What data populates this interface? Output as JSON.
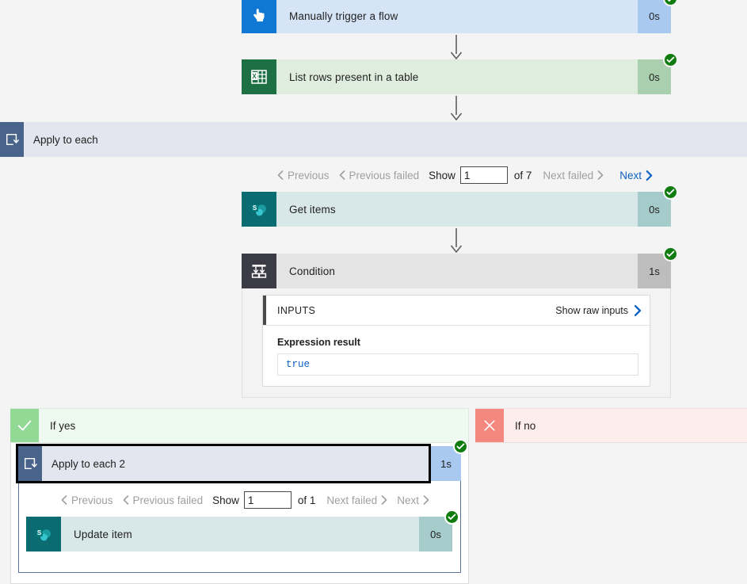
{
  "flow_run": {
    "background_color": "#f4f4f4",
    "status_badge_color": "#107c10",
    "link_color": "#0b61c4",
    "disabled_color": "#a19f9d"
  },
  "steps": {
    "trigger": {
      "name": "Manually trigger a flow",
      "duration": "0s",
      "icon": "tap-hand-icon",
      "icon_bg": "#0f78d4",
      "theme": "blue",
      "status": "succeeded"
    },
    "list_rows": {
      "name": "List rows present in a table",
      "duration": "0s",
      "icon": "excel-icon",
      "icon_bg": "#1d7044",
      "theme": "green",
      "status": "succeeded"
    },
    "get_items": {
      "name": "Get items",
      "duration": "0s",
      "icon": "sharepoint-icon",
      "icon_bg": "#0a6c71",
      "theme": "teal",
      "status": "succeeded"
    },
    "condition": {
      "name": "Condition",
      "duration": "1s",
      "icon": "condition-branch-icon",
      "icon_bg": "#3b3b45",
      "theme": "gray",
      "status": "succeeded"
    },
    "update_item": {
      "name": "Update item",
      "duration": "0s",
      "icon": "sharepoint-icon",
      "icon_bg": "#0a6c71",
      "theme": "teal",
      "status": "succeeded"
    }
  },
  "apply_to_each": {
    "label": "Apply to each",
    "icon": "loop-icon",
    "pager": {
      "previous_label": "Previous",
      "previous_failed_label": "Previous failed",
      "show_label": "Show",
      "page_value": "1",
      "of_label": "of 7",
      "next_failed_label": "Next failed",
      "next_label": "Next",
      "previous_enabled": false,
      "previous_failed_enabled": false,
      "next_failed_enabled": false,
      "next_enabled": true
    }
  },
  "apply_to_each_2": {
    "label": "Apply to each 2",
    "icon": "loop-icon",
    "duration": "1s",
    "status": "succeeded",
    "selected": true,
    "pager": {
      "previous_label": "Previous",
      "previous_failed_label": "Previous failed",
      "show_label": "Show",
      "page_value": "1",
      "of_label": "of 1",
      "next_failed_label": "Next failed",
      "next_label": "Next",
      "previous_enabled": false,
      "previous_failed_enabled": false,
      "next_failed_enabled": false,
      "next_enabled": false
    }
  },
  "inputs_panel": {
    "title": "INPUTS",
    "raw_link": "Show raw inputs",
    "field_label": "Expression result",
    "field_value": "true"
  },
  "branches": {
    "yes": {
      "label": "If yes",
      "icon": "check-icon"
    },
    "no": {
      "label": "If no",
      "icon": "x-icon"
    }
  }
}
